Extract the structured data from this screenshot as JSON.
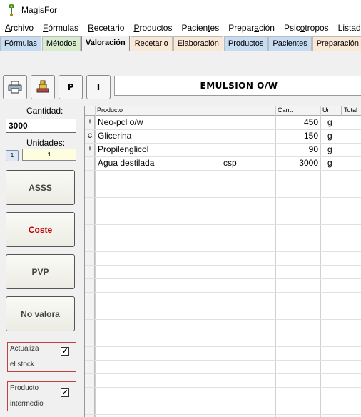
{
  "window": {
    "title": "MagisFor",
    "icon": "app-logo-icon"
  },
  "menu": [
    {
      "label": "Archivo",
      "accel": "A",
      "rest": "rchivo"
    },
    {
      "label": "Fórmulas",
      "accel": "F",
      "rest": "órmulas"
    },
    {
      "label": "Recetario",
      "accel": "R",
      "rest": "ecetario"
    },
    {
      "label": "Productos",
      "accel": "P",
      "rest": "roductos"
    },
    {
      "label": "Pacientes",
      "pre": "Pacien",
      "accel": "t",
      "rest": "es"
    },
    {
      "label": "Preparación",
      "pre": "Prepar",
      "accel": "a",
      "rest": "ción"
    },
    {
      "label": "Psicotropos",
      "pre": "Psic",
      "accel": "o",
      "rest": "tropos"
    },
    {
      "label": "Listados",
      "pre": "Listad",
      "accel": "",
      "rest": ""
    }
  ],
  "tabs": [
    {
      "label": "Fórmulas",
      "style": "blue"
    },
    {
      "label": "Métodos",
      "style": "green"
    },
    {
      "label": "Valoración",
      "style": "active"
    },
    {
      "label": "Recetario",
      "style": "peach"
    },
    {
      "label": "Elaboración",
      "style": "peach"
    },
    {
      "label": "Productos",
      "style": "blue"
    },
    {
      "label": "Pacientes",
      "style": "blue"
    },
    {
      "label": "Preparación",
      "style": "peach"
    }
  ],
  "toolbar": {
    "print_icon": "printer-icon",
    "stamp_icon": "stamp-icon",
    "p_label": "P",
    "i_label": "I",
    "formula_title": "EMULSION O/W"
  },
  "left": {
    "cantidad_label": "Cantidad:",
    "cantidad_value": "3000",
    "unidades_label": "Unidades:",
    "unidades_small_btn": "1",
    "unidades_value": "1",
    "btn_asss": "ASSS",
    "btn_coste": "Coste",
    "btn_pvp": "PVP",
    "btn_novalora": "No valora",
    "check1_line1": "Actualiza",
    "check1_line2": "el stock",
    "check1_checked": true,
    "check2_line1": "Producto",
    "check2_line2": "intermedio",
    "check2_checked": true
  },
  "grid": {
    "columns": [
      "Producto",
      "Cant.",
      "Un",
      "Total"
    ],
    "rows": [
      {
        "ind": "!",
        "producto": "Neo-pcl o/w",
        "extra": "",
        "cant": "450",
        "un": "g"
      },
      {
        "ind": "C",
        "producto": "Glicerina",
        "extra": "",
        "cant": "150",
        "un": "g"
      },
      {
        "ind": "!",
        "producto": "Propilenglicol",
        "extra": "",
        "cant": "90",
        "un": "g"
      },
      {
        "ind": "",
        "producto": "Agua destilada",
        "extra": "csp",
        "cant": "3000",
        "un": "g"
      }
    ]
  },
  "colors": {
    "coste_text": "#c00000",
    "check_border": "#c04040",
    "units_bg": "#fffde0"
  }
}
